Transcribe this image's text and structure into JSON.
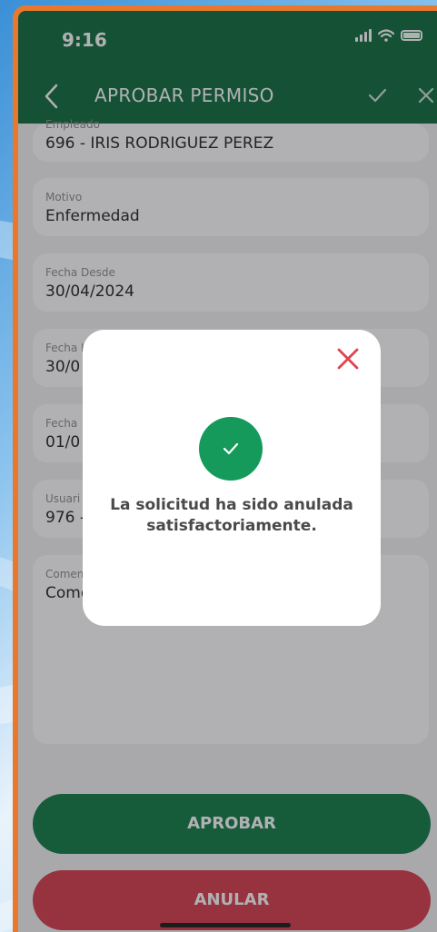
{
  "status_bar": {
    "time": "9:16",
    "icons": [
      "signal-icon",
      "wifi-icon",
      "battery-icon"
    ]
  },
  "header": {
    "title": "APROBAR PERMISO",
    "back_icon": "chevron-left-icon",
    "confirm_icon": "check-icon",
    "close_icon": "close-icon",
    "color": "#0b6b3b"
  },
  "form": {
    "fields": [
      {
        "label": "Empleado",
        "value": "696 - IRIS RODRIGUEZ PEREZ"
      },
      {
        "label": "Motivo",
        "value": "Enfermedad"
      },
      {
        "label": "Fecha Desde",
        "value": "30/04/2024"
      },
      {
        "label": "Fecha H",
        "value": "30/0"
      },
      {
        "label": "Fecha",
        "value": "01/0"
      },
      {
        "label": "Usuari",
        "value": "976 -"
      },
      {
        "label": "Comen",
        "value": "Come"
      }
    ]
  },
  "buttons": {
    "approve_label": "APROBAR",
    "cancel_label": "ANULAR",
    "approve_color": "#0d7a44",
    "cancel_color": "#d63a48"
  },
  "modal": {
    "message": "La solicitud ha sido anulada satisfactoriamente.",
    "close_icon": "close-icon",
    "success_icon": "check-circle-icon",
    "success_color": "#159a5b",
    "close_color": "#e0434f"
  }
}
